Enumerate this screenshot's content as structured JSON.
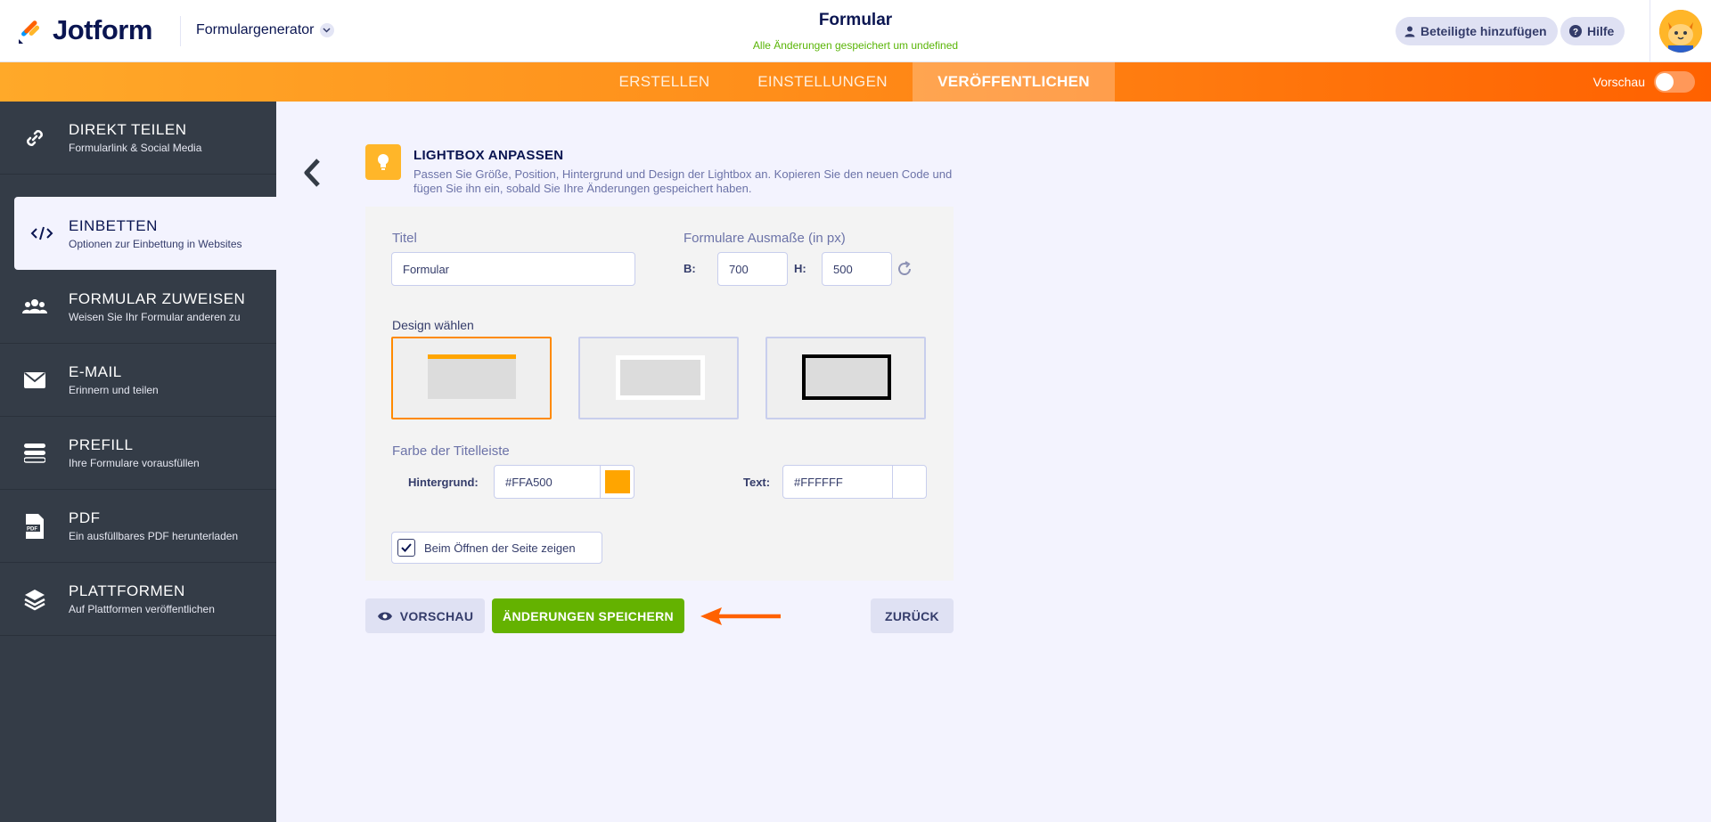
{
  "header": {
    "logo_text": "Jotform",
    "generator_label": "Formulargenerator",
    "form_title": "Formular",
    "save_status": "Alle Änderungen gespeichert um undefined",
    "add_participants_label": "Beteiligte hinzufügen",
    "help_label": "Hilfe"
  },
  "nav": {
    "tabs": [
      {
        "label": "ERSTELLEN"
      },
      {
        "label": "EINSTELLUNGEN"
      },
      {
        "label": "VERÖFFENTLICHEN"
      }
    ],
    "active_tab": "VERÖFFENTLICHEN",
    "preview_label": "Vorschau"
  },
  "sidebar": {
    "items": [
      {
        "label": "DIREKT TEILEN",
        "sub": "Formularlink & Social Media",
        "icon": "link-icon"
      },
      {
        "label": "EINBETTEN",
        "sub": "Optionen zur Einbettung in Websites",
        "icon": "code-icon"
      },
      {
        "label": "FORMULAR ZUWEISEN",
        "sub": "Weisen Sie Ihr Formular anderen zu",
        "icon": "users-icon"
      },
      {
        "label": "E-MAIL",
        "sub": "Erinnern und teilen",
        "icon": "envelope-icon"
      },
      {
        "label": "PREFILL",
        "sub": "Ihre Formulare vorausfüllen",
        "icon": "prefill-icon"
      },
      {
        "label": "PDF",
        "sub": "Ein ausfüllbares PDF herunterladen",
        "icon": "pdf-icon"
      },
      {
        "label": "PLATTFORMEN",
        "sub": "Auf Plattformen veröffentlichen",
        "icon": "layers-icon"
      }
    ],
    "active_item": "EINBETTEN"
  },
  "lightbox": {
    "heading": "LIGHTBOX ANPASSEN",
    "description": "Passen Sie Größe, Position, Hintergrund und Design der Lightbox an. Kopieren Sie den neuen Code und fügen Sie ihn ein, sobald Sie Ihre Änderungen gespeichert haben.",
    "title_label": "Titel",
    "title_value": "Formular",
    "size_label": "Formulare Ausmaße (in px)",
    "width_label": "B:",
    "width_value": "700",
    "height_label": "H:",
    "height_value": "500",
    "design_label": "Design wählen",
    "selected_design": 1,
    "titlebar_color_label": "Farbe der Titelleiste",
    "bg_label": "Hintergrund:",
    "bg_value": "#FFA500",
    "text_label": "Text:",
    "text_value": "#FFFFFF",
    "show_on_open_label": "Beim Öffnen der Seite zeigen",
    "show_on_open_checked": true
  },
  "buttons": {
    "preview": "VORSCHAU",
    "save": "ÄNDERUNGEN SPEICHERN",
    "back": "ZURÜCK"
  },
  "colors": {
    "accent_orange": "#FF6100",
    "save_green": "#64B200",
    "sidebar_bg": "#343C47",
    "titlebar_bg": "#FFA500",
    "titlebar_text": "#FFFFFF"
  }
}
